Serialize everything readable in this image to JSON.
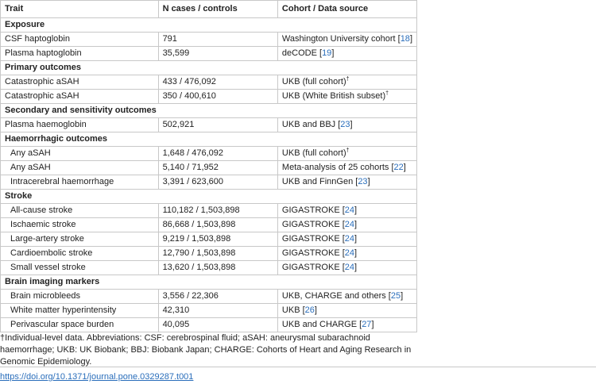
{
  "headers": [
    "Trait",
    "N cases / controls",
    "Cohort / Data source"
  ],
  "rows": [
    {
      "type": "section",
      "trait": "Exposure"
    },
    {
      "type": "row",
      "trait": "CSF haptoglobin",
      "n": "791",
      "source": "Washington University cohort [",
      "ref": "18",
      "after": "]"
    },
    {
      "type": "row",
      "trait": "Plasma haptoglobin",
      "n": "35,599",
      "source": "deCODE [",
      "ref": "19",
      "after": "]"
    },
    {
      "type": "section",
      "trait": "Primary outcomes"
    },
    {
      "type": "row",
      "trait": "Catastrophic aSAH",
      "n": "433 / 476,092",
      "source": "UKB (full cohort)",
      "dagger": "†"
    },
    {
      "type": "row",
      "trait": "Catastrophic aSAH",
      "n": "350 / 400,610",
      "source": "UKB (White British subset)",
      "dagger": "†"
    },
    {
      "type": "section",
      "trait": "Secondary and sensitivity outcomes"
    },
    {
      "type": "row",
      "trait": "Plasma haemoglobin",
      "n": "502,921",
      "source": "UKB and BBJ [",
      "ref": "23",
      "after": "]"
    },
    {
      "type": "section",
      "trait": "Haemorrhagic outcomes"
    },
    {
      "type": "row",
      "indent": true,
      "trait": "Any aSAH",
      "n": "1,648 / 476,092",
      "source": "UKB (full cohort)",
      "dagger": "†"
    },
    {
      "type": "row",
      "indent": true,
      "trait": "Any aSAH",
      "n": "5,140 / 71,952",
      "source": "Meta-analysis of 25 cohorts [",
      "ref": "22",
      "after": "]"
    },
    {
      "type": "row",
      "indent": true,
      "trait": "Intracerebral haemorrhage",
      "n": "3,391 / 623,600",
      "source": "UKB and FinnGen [",
      "ref": "23",
      "after": "]"
    },
    {
      "type": "section",
      "trait": "Stroke"
    },
    {
      "type": "row",
      "indent": true,
      "trait": "All-cause stroke",
      "n": "110,182 / 1,503,898",
      "source": "GIGASTROKE [",
      "ref": "24",
      "after": "]"
    },
    {
      "type": "row",
      "indent": true,
      "trait": "Ischaemic stroke",
      "n": "86,668 / 1,503,898",
      "source": "GIGASTROKE [",
      "ref": "24",
      "after": "]"
    },
    {
      "type": "row",
      "indent": true,
      "trait": "Large-artery stroke",
      "n": "9,219 / 1,503,898",
      "source": "GIGASTROKE [",
      "ref": "24",
      "after": "]"
    },
    {
      "type": "row",
      "indent": true,
      "trait": "Cardioembolic stroke",
      "n": "12,790 / 1,503,898",
      "source": "GIGASTROKE [",
      "ref": "24",
      "after": "]"
    },
    {
      "type": "row",
      "indent": true,
      "trait": "Small vessel stroke",
      "n": "13,620 / 1,503,898",
      "source": "GIGASTROKE [",
      "ref": "24",
      "after": "]"
    },
    {
      "type": "section",
      "trait": "Brain imaging markers"
    },
    {
      "type": "row",
      "indent": true,
      "trait": "Brain microbleeds",
      "n": "3,556 / 22,306",
      "source": "UKB, CHARGE and others [",
      "ref": "25",
      "after": "]"
    },
    {
      "type": "row",
      "indent": true,
      "trait": "White matter hyperintensity",
      "n": "42,310",
      "source": "UKB [",
      "ref": "26",
      "after": "]"
    },
    {
      "type": "row",
      "indent": true,
      "trait": "Perivascular space burden",
      "n": "40,095",
      "source": "UKB and CHARGE [",
      "ref": "27",
      "after": "]"
    }
  ],
  "footnote": "†Individual-level data. Abbreviations: CSF: cerebrospinal fluid; aSAH: aneurysmal subarachnoid haemorrhage; UKB: UK Biobank; BBJ: Biobank Japan; CHARGE: Cohorts of Heart and Aging Research in Genomic Epidemiology.",
  "doi": "https://doi.org/10.1371/journal.pone.0329287.t001"
}
